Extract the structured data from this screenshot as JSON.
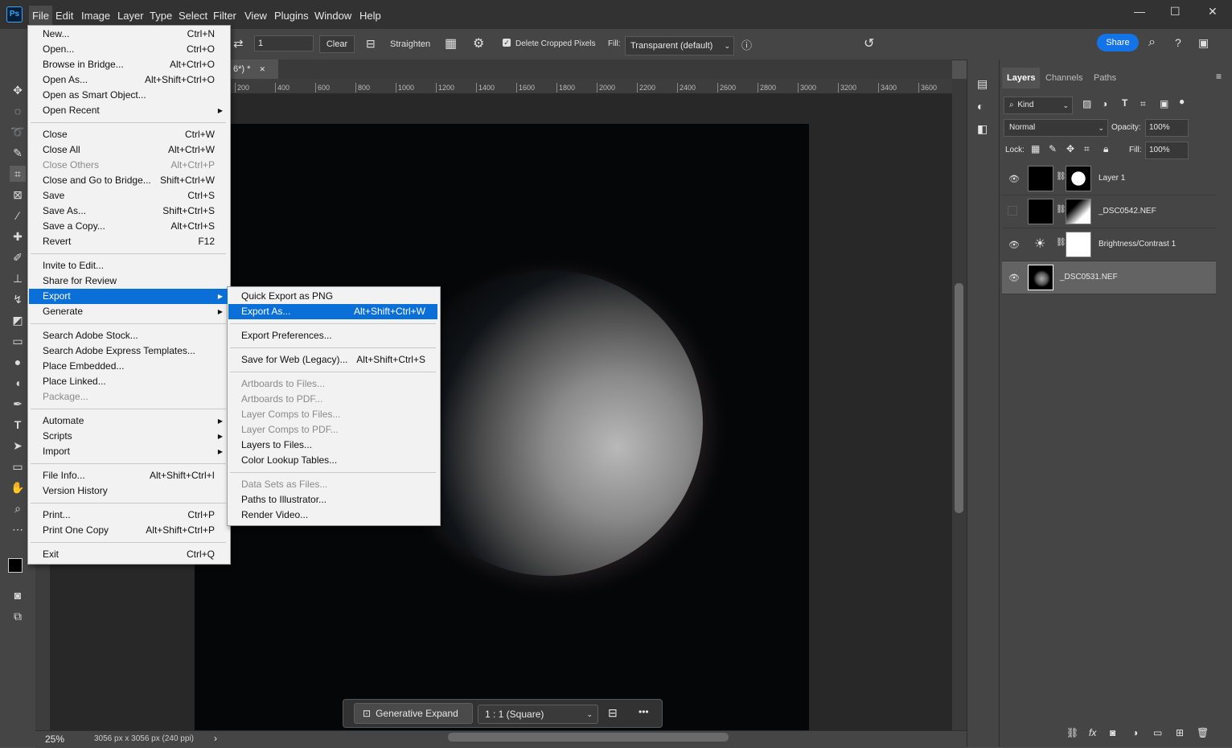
{
  "menubar": {
    "logo": "Ps",
    "items": [
      "File",
      "Edit",
      "Image",
      "Layer",
      "Type",
      "Select",
      "Filter",
      "View",
      "Plugins",
      "Window",
      "Help"
    ],
    "window_controls": [
      "—",
      "☐",
      "✕"
    ]
  },
  "options_bar": {
    "value_field": "1",
    "clear_label": "Clear",
    "straighten_label": "Straighten",
    "delete_cropped_label": "Delete Cropped Pixels",
    "delete_cropped_checked": true,
    "fill_label": "Fill:",
    "fill_value": "Transparent (default)",
    "share_label": "Share"
  },
  "document": {
    "tab_title": "6*) *",
    "tab_close": "✕",
    "ruler_ticks": [
      "200",
      "400",
      "600",
      "800",
      "1000",
      "1200",
      "1400",
      "1600",
      "1800",
      "2000",
      "2200",
      "2400",
      "2600",
      "2800",
      "3000",
      "3200",
      "3400",
      "3600"
    ],
    "zoom": "25%",
    "size_info": "3056 px x 3056 px (240 ppi)"
  },
  "taskbar": {
    "generative_expand_label": "Generative Expand",
    "ratio_value": "1 : 1 (Square)",
    "more": "•••"
  },
  "layers_panel": {
    "tabs": [
      "Layers",
      "Channels",
      "Paths"
    ],
    "kind_label": "Kind",
    "blend_mode": "Normal",
    "opacity_label": "Opacity:",
    "opacity_value": "100%",
    "lock_label": "Lock:",
    "fill_label": "Fill:",
    "fill_value": "100%",
    "layers": [
      {
        "name": "Layer 1",
        "visible": true
      },
      {
        "name": "_DSC0542.NEF",
        "visible": false
      },
      {
        "name": "Brightness/Contrast 1",
        "visible": true
      },
      {
        "name": "_DSC0531.NEF",
        "visible": true
      }
    ]
  },
  "file_menu": {
    "groups": [
      [
        {
          "label": "New...",
          "shortcut": "Ctrl+N"
        },
        {
          "label": "Open...",
          "shortcut": "Ctrl+O"
        },
        {
          "label": "Browse in Bridge...",
          "shortcut": "Alt+Ctrl+O"
        },
        {
          "label": "Open As...",
          "shortcut": "Alt+Shift+Ctrl+O"
        },
        {
          "label": "Open as Smart Object...",
          "shortcut": ""
        },
        {
          "label": "Open Recent",
          "shortcut": "",
          "submenu": true
        }
      ],
      [
        {
          "label": "Close",
          "shortcut": "Ctrl+W"
        },
        {
          "label": "Close All",
          "shortcut": "Alt+Ctrl+W"
        },
        {
          "label": "Close Others",
          "shortcut": "Alt+Ctrl+P",
          "disabled": true
        },
        {
          "label": "Close and Go to Bridge...",
          "shortcut": "Shift+Ctrl+W"
        },
        {
          "label": "Save",
          "shortcut": "Ctrl+S"
        },
        {
          "label": "Save As...",
          "shortcut": "Shift+Ctrl+S"
        },
        {
          "label": "Save a Copy...",
          "shortcut": "Alt+Ctrl+S"
        },
        {
          "label": "Revert",
          "shortcut": "F12"
        }
      ],
      [
        {
          "label": "Invite to Edit...",
          "shortcut": ""
        },
        {
          "label": "Share for Review",
          "shortcut": ""
        },
        {
          "label": "Export",
          "shortcut": "",
          "submenu": true,
          "highlighted": true
        },
        {
          "label": "Generate",
          "shortcut": "",
          "submenu": true
        }
      ],
      [
        {
          "label": "Search Adobe Stock...",
          "shortcut": ""
        },
        {
          "label": "Search Adobe Express Templates...",
          "shortcut": ""
        },
        {
          "label": "Place Embedded...",
          "shortcut": ""
        },
        {
          "label": "Place Linked...",
          "shortcut": ""
        },
        {
          "label": "Package...",
          "shortcut": "",
          "disabled": true
        }
      ],
      [
        {
          "label": "Automate",
          "shortcut": "",
          "submenu": true
        },
        {
          "label": "Scripts",
          "shortcut": "",
          "submenu": true
        },
        {
          "label": "Import",
          "shortcut": "",
          "submenu": true
        }
      ],
      [
        {
          "label": "File Info...",
          "shortcut": "Alt+Shift+Ctrl+I"
        },
        {
          "label": "Version History",
          "shortcut": ""
        }
      ],
      [
        {
          "label": "Print...",
          "shortcut": "Ctrl+P"
        },
        {
          "label": "Print One Copy",
          "shortcut": "Alt+Shift+Ctrl+P"
        }
      ],
      [
        {
          "label": "Exit",
          "shortcut": "Ctrl+Q"
        }
      ]
    ]
  },
  "export_submenu": {
    "groups": [
      [
        {
          "label": "Quick Export as PNG",
          "shortcut": ""
        },
        {
          "label": "Export As...",
          "shortcut": "Alt+Shift+Ctrl+W",
          "highlighted": true
        }
      ],
      [
        {
          "label": "Export Preferences...",
          "shortcut": ""
        }
      ],
      [
        {
          "label": "Save for Web (Legacy)...",
          "shortcut": "Alt+Shift+Ctrl+S"
        }
      ],
      [
        {
          "label": "Artboards to Files...",
          "shortcut": "",
          "disabled": true
        },
        {
          "label": "Artboards to PDF...",
          "shortcut": "",
          "disabled": true
        },
        {
          "label": "Layer Comps to Files...",
          "shortcut": "",
          "disabled": true
        },
        {
          "label": "Layer Comps to PDF...",
          "shortcut": "",
          "disabled": true
        },
        {
          "label": "Layers to Files...",
          "shortcut": ""
        },
        {
          "label": "Color Lookup Tables...",
          "shortcut": ""
        }
      ],
      [
        {
          "label": "Data Sets as Files...",
          "shortcut": "",
          "disabled": true
        },
        {
          "label": "Paths to Illustrator...",
          "shortcut": ""
        },
        {
          "label": "Render Video...",
          "shortcut": ""
        }
      ]
    ]
  }
}
